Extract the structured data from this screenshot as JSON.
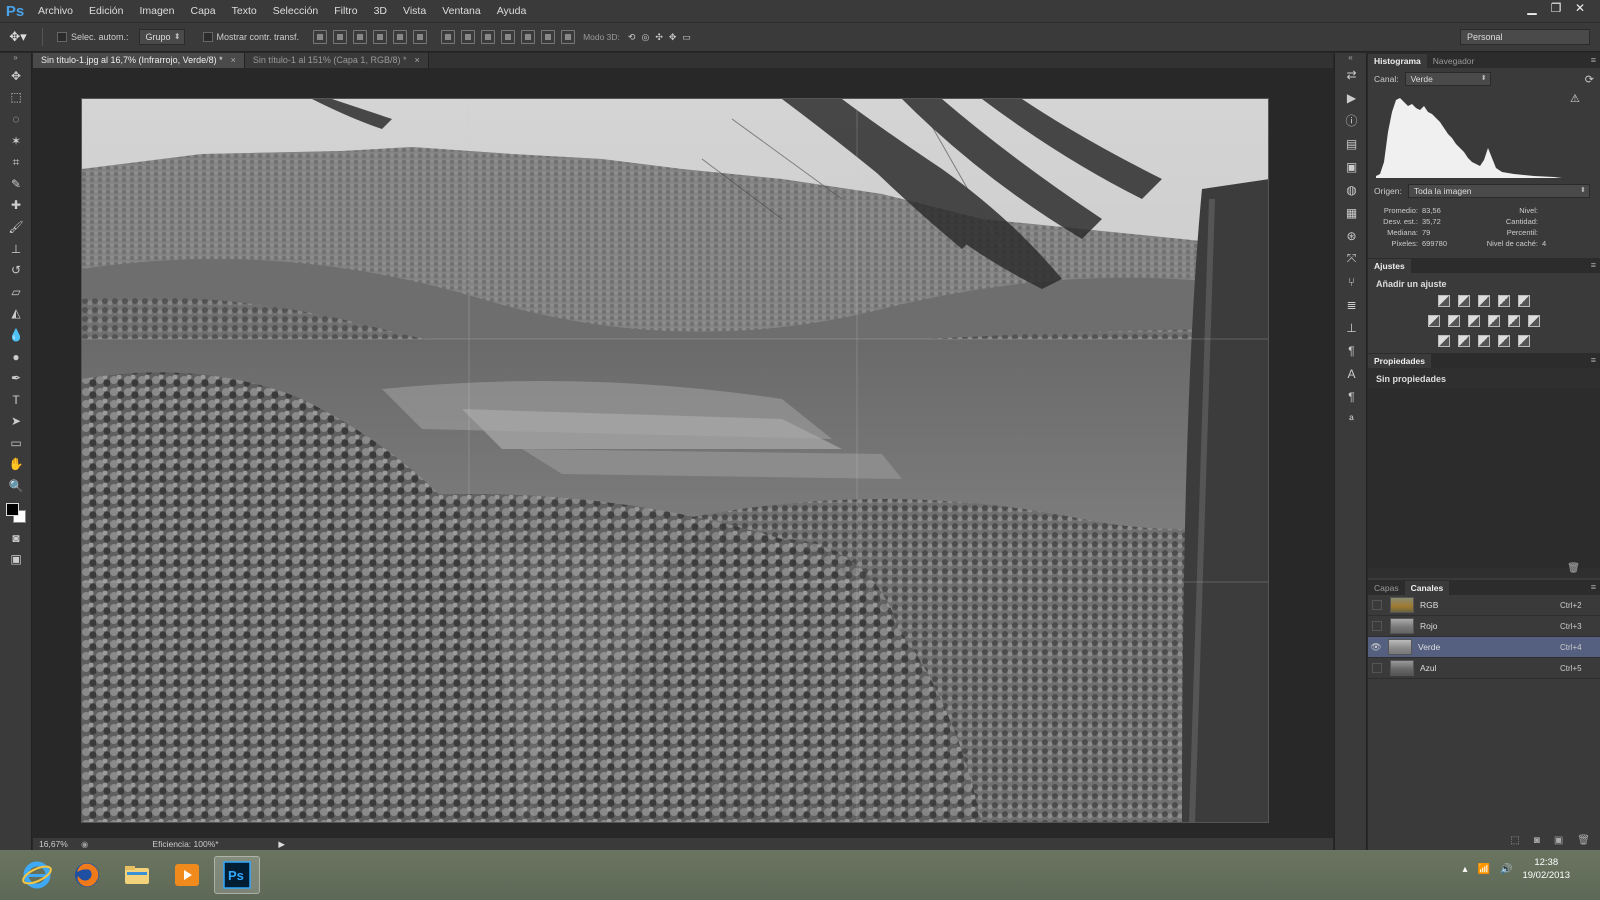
{
  "app": {
    "logo": "Ps"
  },
  "menu": [
    "Archivo",
    "Edición",
    "Imagen",
    "Capa",
    "Texto",
    "Selección",
    "Filtro",
    "3D",
    "Vista",
    "Ventana",
    "Ayuda"
  ],
  "window_controls": [
    "minimize-icon",
    "restore-icon",
    "close-icon"
  ],
  "options": {
    "auto_select_label": "Selec. autom.:",
    "auto_select_value": "Grupo",
    "show_transform_label": "Mostrar contr. transf.",
    "mode3d_label": "Modo 3D:",
    "workspace": "Personal"
  },
  "tabs": [
    {
      "label": "Sin título-1.jpg al 16,7% (Infrarrojo, Verde/8) *",
      "active": true
    },
    {
      "label": "Sin título-1 al 151% (Capa 1, RGB/8) *",
      "active": false
    }
  ],
  "status": {
    "zoom": "16,67%",
    "info": "Eficiencia: 100%*"
  },
  "histogram": {
    "tabs": [
      "Histograma",
      "Navegador"
    ],
    "channel_label": "Canal:",
    "channel_value": "Verde",
    "source_label": "Origen:",
    "source_value": "Toda la imagen",
    "stats": {
      "mean_label": "Promedio:",
      "mean": "83,56",
      "stddev_label": "Desv. est.:",
      "stddev": "35,72",
      "median_label": "Mediana:",
      "median": "79",
      "pixels_label": "Píxeles:",
      "pixels": "699780",
      "level_label": "Nivel:",
      "count_label": "Cantidad:",
      "percentile_label": "Percentil:",
      "cache_label": "Nivel de caché:",
      "cache": "4"
    }
  },
  "adjustments": {
    "tab": "Ajustes",
    "title": "Añadir un ajuste"
  },
  "properties": {
    "tab": "Propiedades",
    "empty": "Sin propiedades"
  },
  "layers": {
    "tabs": [
      "Capas",
      "Canales"
    ],
    "channels": [
      {
        "name": "RGB",
        "shortcut": "Ctrl+2",
        "visible": false,
        "active": false
      },
      {
        "name": "Rojo",
        "shortcut": "Ctrl+3",
        "visible": false,
        "active": false
      },
      {
        "name": "Verde",
        "shortcut": "Ctrl+4",
        "visible": true,
        "active": true
      },
      {
        "name": "Azul",
        "shortcut": "Ctrl+5",
        "visible": false,
        "active": false
      }
    ]
  },
  "taskbar": {
    "apps": [
      "internet-explorer-icon",
      "firefox-icon",
      "file-explorer-icon",
      "media-player-icon",
      "photoshop-icon"
    ],
    "time": "12:38",
    "date": "19/02/2013"
  }
}
